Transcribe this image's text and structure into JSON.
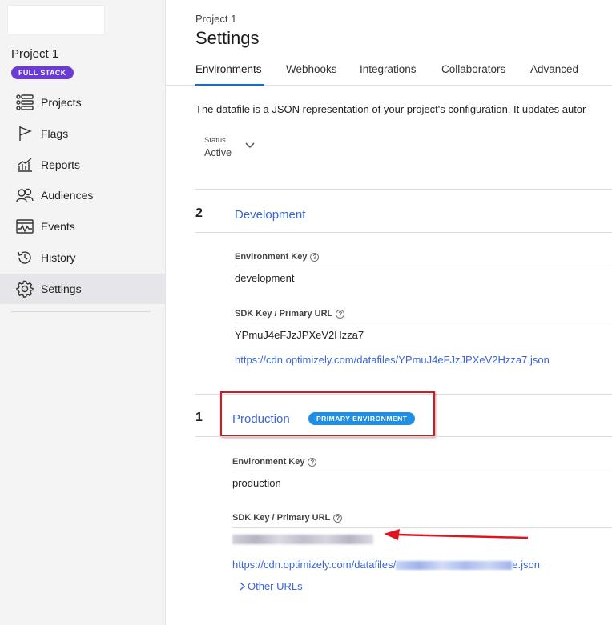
{
  "sidebar": {
    "project_name": "Project 1",
    "badge": "FULL STACK",
    "items": [
      {
        "label": "Projects",
        "icon": "list-icon"
      },
      {
        "label": "Flags",
        "icon": "flag-icon"
      },
      {
        "label": "Reports",
        "icon": "chart-icon"
      },
      {
        "label": "Audiences",
        "icon": "people-icon"
      },
      {
        "label": "Events",
        "icon": "pulse-icon"
      },
      {
        "label": "History",
        "icon": "history-icon"
      },
      {
        "label": "Settings",
        "icon": "gear-icon",
        "active": true
      }
    ]
  },
  "header": {
    "breadcrumb": "Project 1",
    "title": "Settings"
  },
  "tabs": [
    {
      "label": "Environments",
      "active": true
    },
    {
      "label": "Webhooks"
    },
    {
      "label": "Integrations"
    },
    {
      "label": "Collaborators"
    },
    {
      "label": "Advanced"
    }
  ],
  "description": "The datafile is a JSON representation of your project's configuration. It updates autor",
  "status": {
    "label": "Status",
    "value": "Active"
  },
  "environments": [
    {
      "priority": "2",
      "name": "Development",
      "key_label": "Environment Key",
      "key_value": "development",
      "sdk_label": "SDK Key / Primary URL",
      "sdk_value": "YPmuJ4eFJzJPXeV2Hzza7",
      "url": "https://cdn.optimizely.com/datafiles/YPmuJ4eFJzJPXeV2Hzza7.json"
    },
    {
      "priority": "1",
      "name": "Production",
      "badge": "PRIMARY ENVIRONMENT",
      "key_label": "Environment Key",
      "key_value": "production",
      "sdk_label": "SDK Key / Primary URL",
      "url_prefix": "https://cdn.optimizely.com/datafiles/",
      "url_suffix": "e.json",
      "other_urls": "Other URLs"
    }
  ],
  "colors": {
    "accent": "#0a6cf3",
    "link": "#3a66d8",
    "badge_purple": "#6b3bd6",
    "badge_blue": "#1f8fe5",
    "annotation_red": "#e0141c"
  }
}
